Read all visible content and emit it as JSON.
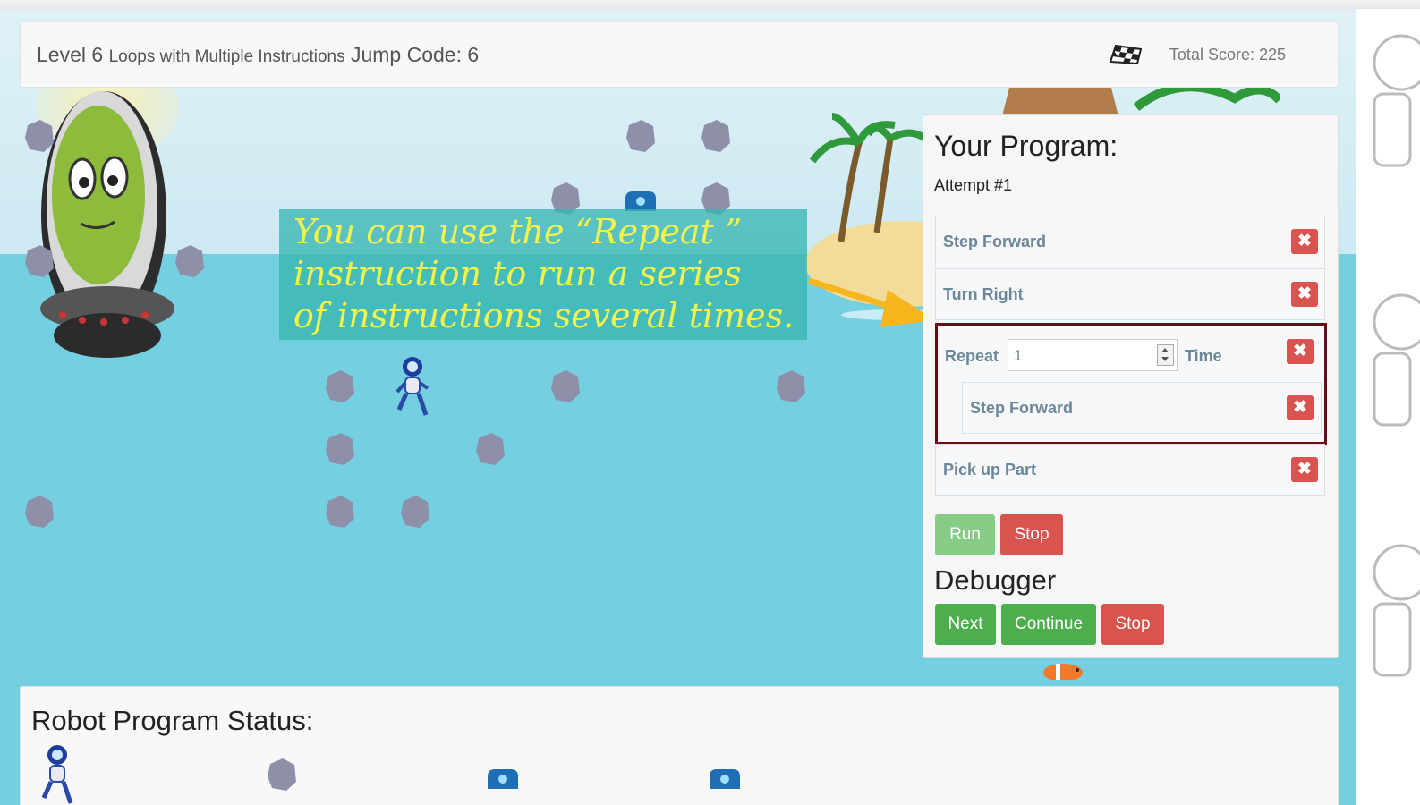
{
  "header": {
    "level_label": "Level 6",
    "level_title": "Loops with Multiple Instructions",
    "jump_code": "Jump Code: 6",
    "total_score": "Total Score: 225"
  },
  "callout": {
    "text": "You can use the “Repeat ”\ninstruction to run a series\nof instructions several times."
  },
  "program": {
    "title": "Your Program:",
    "attempt": "Attempt #1",
    "steps": [
      "Step Forward",
      "Turn Right"
    ],
    "repeat": {
      "label": "Repeat",
      "count": "1",
      "unit": "Time",
      "inner": "Step Forward"
    },
    "after": "Pick up Part",
    "remove_symbol": "✖",
    "run_label": "Run",
    "stop_label": "Stop"
  },
  "debugger": {
    "title": "Debugger",
    "next_label": "Next",
    "continue_label": "Continue",
    "stop_label": "Stop"
  },
  "status": {
    "title": "Robot Program Status:"
  },
  "colors": {
    "danger": "#d9534f",
    "success": "#4cae4c",
    "sea": "#74cfe0",
    "callout_text": "#f2f24a",
    "repeat_border": "#6b0b17"
  },
  "icons": [
    "checkered-flag-icon",
    "remove-icon",
    "spinner-arrows-icon",
    "arrow-icon"
  ]
}
